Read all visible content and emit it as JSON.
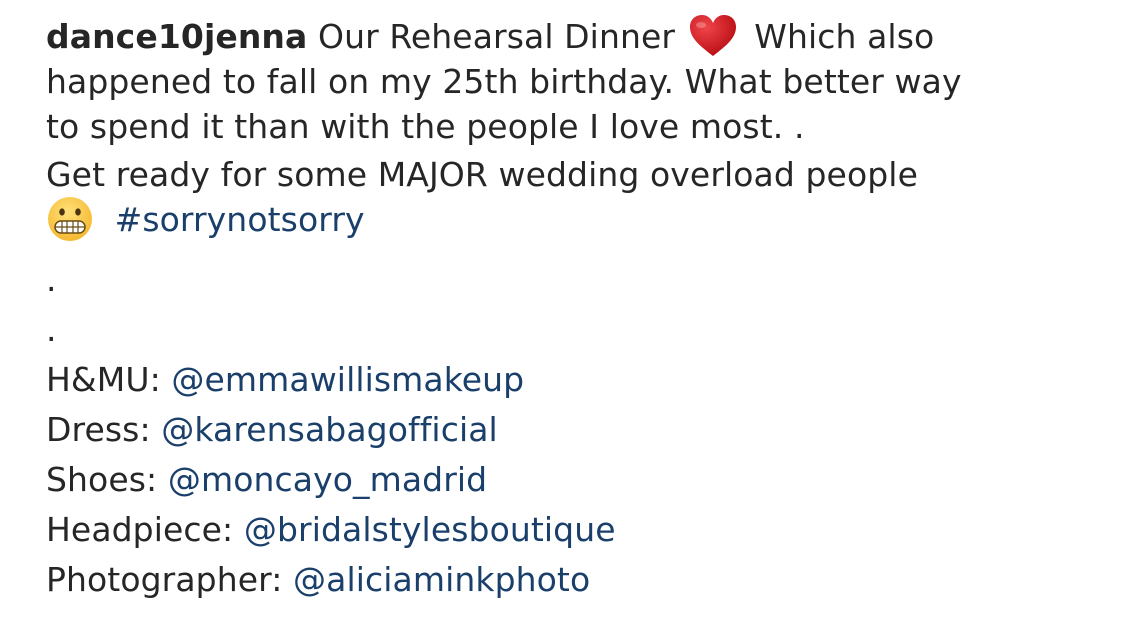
{
  "post": {
    "username": "dance10jenna",
    "caption_line1_a": "Our Rehearsal Dinner",
    "caption_line1_b": "Which also",
    "caption_line2": "happened to fall on my 25th birthday. What better way",
    "caption_line3": "to spend it than with the people I love most. .",
    "caption_line4": "Get ready for some MAJOR wedding overload people",
    "hashtag": "#sorrynotsorry",
    "dot1": ".",
    "dot2": ".",
    "icons": {
      "heart": "red-heart-emoji",
      "grimace": "grimacing-face-emoji"
    },
    "colors": {
      "text": "#262626",
      "link": "#1a3f6b",
      "heart": "#d0181c"
    },
    "credits": [
      {
        "label": "H&MU:",
        "handle": "@emmawillismakeup"
      },
      {
        "label": "Dress:",
        "handle": "@karensabagofficial"
      },
      {
        "label": "Shoes:",
        "handle": "@moncayo_madrid"
      },
      {
        "label": "Headpiece:",
        "handle": "@bridalstylesboutique"
      },
      {
        "label": "Photographer:",
        "handle": "@aliciaminkphoto"
      }
    ]
  }
}
